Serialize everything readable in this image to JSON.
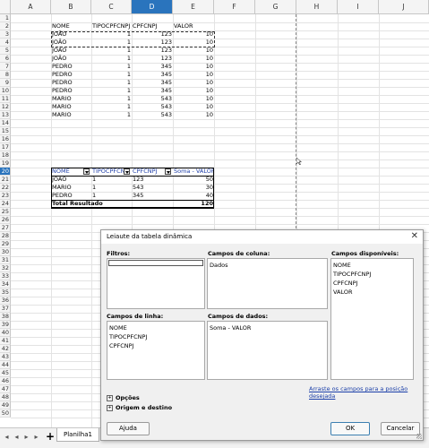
{
  "column_headers": [
    "A",
    "B",
    "C",
    "D",
    "E",
    "F",
    "G",
    "H",
    "I",
    "J"
  ],
  "selected_column": "D",
  "row_numbers": [
    "1",
    "2",
    "3",
    "4",
    "5",
    "6",
    "7",
    "8",
    "9",
    "10",
    "11",
    "12",
    "13",
    "14",
    "15",
    "16",
    "17",
    "18",
    "19",
    "20",
    "21",
    "22",
    "23",
    "24",
    "25",
    "26",
    "27",
    "28",
    "29",
    "30",
    "31",
    "32",
    "33",
    "34",
    "35",
    "36",
    "37",
    "38",
    "39",
    "40",
    "41",
    "42",
    "43",
    "44",
    "45",
    "46",
    "47",
    "48",
    "49",
    "50"
  ],
  "selected_row": "20",
  "source_table": {
    "headers": [
      "NOME",
      "TIPOCPFCNPJ",
      "CPFCNPJ",
      "VALOR"
    ],
    "rows": [
      [
        "JOÃO",
        "1",
        "123",
        "10"
      ],
      [
        "JOÃO",
        "1",
        "123",
        "10"
      ],
      [
        "JOÃO",
        "1",
        "123",
        "10"
      ],
      [
        "JOÃO",
        "1",
        "123",
        "10"
      ],
      [
        "PEDRO",
        "1",
        "345",
        "10"
      ],
      [
        "PEDRO",
        "1",
        "345",
        "10"
      ],
      [
        "PEDRO",
        "1",
        "345",
        "10"
      ],
      [
        "PEDRO",
        "1",
        "345",
        "10"
      ],
      [
        "MARIO",
        "1",
        "543",
        "10"
      ],
      [
        "MARIO",
        "1",
        "543",
        "10"
      ],
      [
        "MARIO",
        "1",
        "543",
        "10"
      ]
    ]
  },
  "pivot_table": {
    "headers": [
      "NOME",
      "TIPOCPFCNPJ",
      "CPFCNPJ",
      "Soma - VALOR"
    ],
    "rows": [
      [
        "JOÃO",
        "1",
        "123",
        "50"
      ],
      [
        "MARIO",
        "1",
        "543",
        "30"
      ],
      [
        "PEDRO",
        "1",
        "345",
        "40"
      ]
    ],
    "total_label": "Total Resultado",
    "total_value": "120"
  },
  "tabbar": {
    "nav": [
      "◂",
      "◂",
      "▸",
      "▸"
    ],
    "add": "+",
    "sheet_name": "Planilha1"
  },
  "dialog": {
    "title": "Leiaute da tabela dinâmica",
    "close": "✕",
    "filters_label": "Filtros:",
    "column_fields_label": "Campos de coluna:",
    "column_fields": [
      "Dados"
    ],
    "available_fields_label": "Campos disponíveis:",
    "available_fields": [
      "NOME",
      "TIPOCPFCNPJ",
      "CPFCNPJ",
      "VALOR"
    ],
    "row_fields_label": "Campos de linha:",
    "row_fields": [
      "NOME",
      "TIPOCPFCNPJ",
      "CPFCNPJ"
    ],
    "data_fields_label": "Campos de dados:",
    "data_fields": [
      "Soma - VALOR"
    ],
    "drag_hint": "Arraste os campos para a posição desejada",
    "options_label": "Opções",
    "source_dest_label": "Origem e destino",
    "help_button": "Ajuda",
    "ok_button": "OK",
    "cancel_button": "Cancelar"
  }
}
